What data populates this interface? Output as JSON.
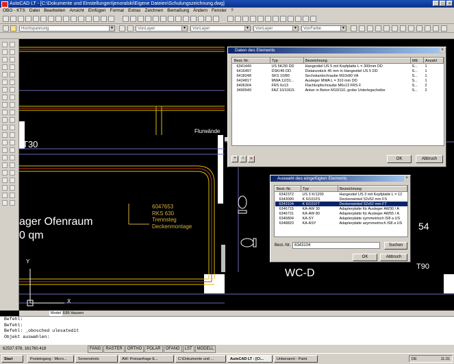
{
  "window": {
    "title": "AutoCAD LT - [C:\\Dokumente und Einstellungen\\jenoralski\\Eigene Dateien\\Schulungszeichnung.dwg]"
  },
  "menu": [
    "OBO - KTS",
    "Datei",
    "Bearbeiten",
    "Ansicht",
    "Einfügen",
    "Format",
    "Extras",
    "Zeichnen",
    "Bemaßung",
    "Ändern",
    "Fenster",
    "?"
  ],
  "layer_toolbar": {
    "layer": "Hochspannung",
    "color": "VonLayer",
    "linetype": "VonLayer",
    "lineweight": "VonLayer",
    "plotstyle": "VonFarbe"
  },
  "drawing": {
    "annotation": [
      "6047653",
      "RKS 630",
      "Trennsteg",
      "Deckenmontage"
    ],
    "room_left_title": "ager Ofenraum",
    "room_left_area": "0 qm",
    "label_t30": "T30",
    "label_flurwaende": "Flurwände",
    "label_wc": "WC-D",
    "label_54": "54",
    "label_t90": "T90",
    "ucs_y": "Y",
    "ucs_x": "X",
    "tabs": [
      "Model",
      "E86 Hausen"
    ]
  },
  "dialog_elements": {
    "title": "Daten des Elements",
    "columns": [
      "Best.-Nr.",
      "Typ",
      "Bezeichnung",
      "ME",
      "Anzahl"
    ],
    "rows": [
      {
        "nr": "6341449",
        "typ": "US 5K/30 DD",
        "bez": "Hangestiel US 5 mit Kopfplatte L = 300mm DD",
        "me": "S...",
        "anz": "1"
      },
      {
        "nr": "6416497",
        "typ": "DSK/45 DD",
        "bez": "Distanzstück 45 mm in Hangestiel US 5 DD",
        "me": "S...",
        "anz": "1"
      },
      {
        "nr": "6418248",
        "typ": "SKS 10/80",
        "bez": "Sechskantschraube M10x80 VA",
        "me": "S...",
        "anz": "1"
      },
      {
        "nr": "6424817",
        "typ": "MWA 12/31...",
        "bez": "Ausleger MWA L = 310 mm DD",
        "me": "S...",
        "anz": "1"
      },
      {
        "nr": "6406304",
        "typ": "FRS 6x13",
        "bez": "Flachkopfschraube M6x13 FRS F",
        "me": "S...",
        "anz": "2"
      },
      {
        "nr": "3490549",
        "typ": "FAZ 10/10GS",
        "bez": "Anker in Beton M10/110, grobe Unterlegscheibe",
        "me": "S...",
        "anz": "2"
      }
    ],
    "ok": "OK",
    "cancel": "Abbruch"
  },
  "dialog_selection": {
    "title": "Auswahl des eingefügten Elements",
    "columns": [
      "Best.-Nr.",
      "Typ",
      "Bezeichnung"
    ],
    "rows": [
      {
        "nr": "6342372",
        "typ": "US 3 K/1200",
        "bez": "Hangestiel US 3 mit Kopfplatte L = 12"
      },
      {
        "nr": "6343090",
        "typ": "K 6/101FS",
        "bez": "Deckenwinkel 52x52 mm FS"
      },
      {
        "nr": "6343104",
        "typ": "K 6/101FT",
        "bez": "Deckenwinkel 52x52 mm FT"
      },
      {
        "nr": "6346715",
        "typ": "KA-AW 30",
        "bez": "Adapterplatte für Ausleger AW30 / A"
      },
      {
        "nr": "6346731",
        "typ": "KA-AW 80",
        "bez": "Adapterplatte für Ausleger AW55 / A"
      },
      {
        "nr": "6346804",
        "typ": "KA-SY",
        "bez": "Adapterplatte symmetrisch IS8 a US"
      },
      {
        "nr": "6348820",
        "typ": "KA-ASY",
        "bez": "Adapterplatte asymmetrisch IS8 a US"
      }
    ],
    "selected_index": 2,
    "search_label": "Best.-Nr.",
    "search_value": "6343104",
    "search_button": "Suchen",
    "ok": "OK",
    "cancel": "Abbruch"
  },
  "command": [
    "Befehl:",
    "Befehl:",
    "Befehl: _obosched ulesatedit",
    "Objekt auswahlen:"
  ],
  "status": {
    "coords": "62537.978, 161760.418",
    "toggles": [
      "FANG",
      "RASTER",
      "ORTHO",
      "POLAR",
      "OFANG",
      "LST",
      "MODELL"
    ]
  },
  "taskbar": {
    "start": "Start",
    "tasks": [
      "Posteingang - Micro...",
      "Screenshots",
      "AW: Preisanfrage E...",
      "C:\\Dokumente und ...",
      "AutoCAD LT - [C\\...",
      "Unbenannt - Paint"
    ],
    "lang": "DE",
    "clock": "11:31"
  },
  "colors": {
    "cad_bg": "#000000",
    "tray_yellow": "#d8c000",
    "tray_red": "#c83a2a",
    "annotation": "#d8b040",
    "selection": "#0a246a"
  }
}
